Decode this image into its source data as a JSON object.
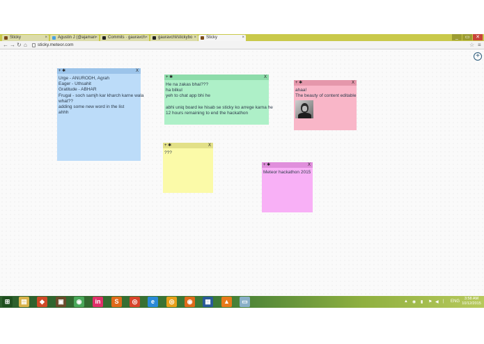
{
  "browser": {
    "tabs": [
      {
        "label": "Sticky",
        "active": false
      },
      {
        "label": "Agustin J (@ajaman",
        "active": false
      },
      {
        "label": "Commits · gauravch",
        "active": false
      },
      {
        "label": "gauravchl/stickybo",
        "active": false
      },
      {
        "label": "Sticky",
        "active": true
      }
    ],
    "url": "sticky.meteor.com",
    "window_buttons": [
      "_",
      "▭",
      "✕"
    ]
  },
  "page": {
    "add_button_label": "+",
    "notes": [
      {
        "color": "#bcdcf9",
        "bar_color": "#9cc4ea",
        "bar_label": "+ ✱",
        "close_label": "X",
        "lines": [
          "Urge - ANURODH, Agrah",
          "Eager - Uthsahit",
          "Gratitude - ABHAR",
          "Frugal - soch samjh kar kharch karne wala",
          "what??",
          "adding some new word in the list",
          "ahhh"
        ]
      },
      {
        "color": "#aef0c8",
        "bar_color": "#8ddcaa",
        "bar_label": "+ ✱",
        "close_label": "X",
        "lines": [
          "He na zakas bhai???",
          "ha bilkul",
          "yeh to chat app bhi he",
          "",
          "abhi uniq board ke hisab se sticky ko arrege karna he",
          "12 hours remaining to end the hackathon"
        ]
      },
      {
        "color": "#f9b6c8",
        "bar_color": "#e597ab",
        "bar_label": "+ ✱",
        "close_label": "X",
        "lines": [
          "ahaa!",
          "The beauty of content editable"
        ],
        "has_avatar": true
      },
      {
        "color": "#fbfaa8",
        "bar_color": "#e2e088",
        "bar_label": "+ ✱",
        "close_label": "X",
        "lines": [
          "???"
        ]
      },
      {
        "color": "#f8b0f6",
        "bar_color": "#e08fdc",
        "bar_label": "+ ✱",
        "close_label": "X",
        "lines": [
          "Meteor hackathon 2015"
        ]
      }
    ]
  },
  "taskbar": {
    "apps": [
      {
        "name": "windows-start-icon",
        "glyph": "⊞",
        "color": "#1f4f1f"
      },
      {
        "name": "file-explorer-icon",
        "glyph": "▤",
        "color": "#d8b24a"
      },
      {
        "name": "git-icon",
        "glyph": "◆",
        "color": "#d04a28"
      },
      {
        "name": "minecraft-icon",
        "glyph": "▣",
        "color": "#6a4a2a"
      },
      {
        "name": "android-studio-icon",
        "glyph": "◉",
        "color": "#4aa85a"
      },
      {
        "name": "invision-icon",
        "glyph": "in",
        "color": "#e0306a"
      },
      {
        "name": "sublime-icon",
        "glyph": "S",
        "color": "#e06a1a"
      },
      {
        "name": "chrome-icon",
        "glyph": "◎",
        "color": "#d8442a"
      },
      {
        "name": "internet-explorer-icon",
        "glyph": "e",
        "color": "#2a8ad8"
      },
      {
        "name": "chrome-canary-icon",
        "glyph": "◎",
        "color": "#e8a01a"
      },
      {
        "name": "firefox-icon",
        "glyph": "◉",
        "color": "#e06a1a"
      },
      {
        "name": "virtualbox-icon",
        "glyph": "▦",
        "color": "#2a5a9a"
      },
      {
        "name": "vlc-icon",
        "glyph": "▲",
        "color": "#e87a1a"
      },
      {
        "name": "remote-desktop-icon",
        "glyph": "▭",
        "color": "#8ab0c8"
      }
    ],
    "tray": {
      "up_arrow": "▲",
      "language": "ENG",
      "time": "3:58 AM",
      "date": "10/12/2015"
    }
  }
}
